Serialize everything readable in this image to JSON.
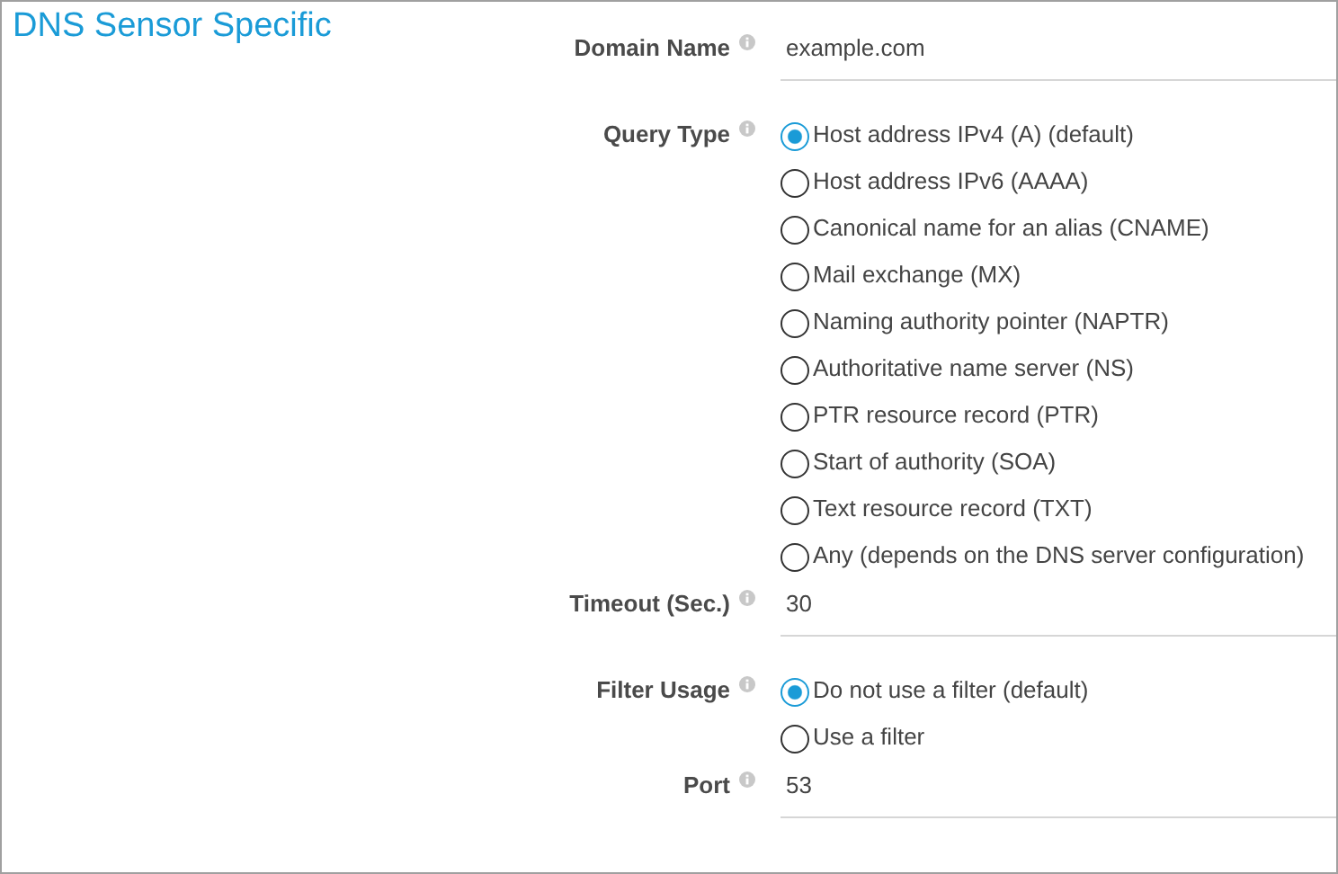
{
  "title": "DNS Sensor Specific",
  "fields": [
    {
      "kind": "text",
      "label": "Domain Name",
      "value": "example.com"
    },
    {
      "kind": "radio",
      "label": "Query Type",
      "options": [
        {
          "label": "Host address IPv4 (A) (default)",
          "selected": true
        },
        {
          "label": "Host address IPv6 (AAAA)",
          "selected": false
        },
        {
          "label": "Canonical name for an alias (CNAME)",
          "selected": false
        },
        {
          "label": "Mail exchange (MX)",
          "selected": false
        },
        {
          "label": "Naming authority pointer (NAPTR)",
          "selected": false
        },
        {
          "label": "Authoritative name server (NS)",
          "selected": false
        },
        {
          "label": "PTR resource record (PTR)",
          "selected": false
        },
        {
          "label": "Start of authority (SOA)",
          "selected": false
        },
        {
          "label": "Text resource record (TXT)",
          "selected": false
        },
        {
          "label": "Any (depends on the DNS server configuration)",
          "selected": false
        }
      ]
    },
    {
      "kind": "text",
      "label": "Timeout (Sec.)",
      "value": "30"
    },
    {
      "kind": "radio",
      "label": "Filter Usage",
      "options": [
        {
          "label": "Do not use a filter (default)",
          "selected": true
        },
        {
          "label": "Use a filter",
          "selected": false
        }
      ]
    },
    {
      "kind": "text",
      "label": "Port",
      "value": "53"
    }
  ]
}
